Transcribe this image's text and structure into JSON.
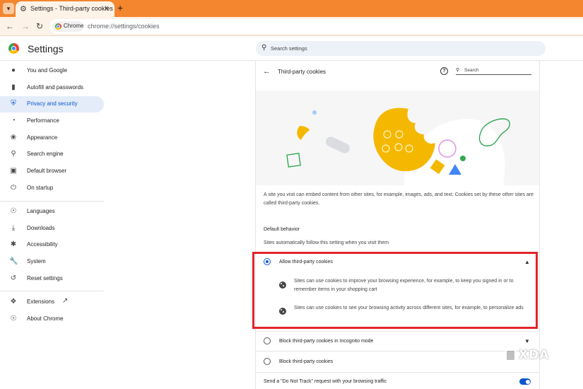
{
  "browser": {
    "tab_title": "Settings - Third-party cookies",
    "tab_menu_icon": "chevron-down-icon",
    "new_tab_label": "+",
    "close_label": "×",
    "site_chip": "Chrome",
    "url": "chrome://settings/cookies"
  },
  "header": {
    "title": "Settings",
    "search_placeholder": "Search settings"
  },
  "sidebar": {
    "items": [
      {
        "label": "You and Google",
        "icon": "person-icon"
      },
      {
        "label": "Autofill and passwords",
        "icon": "clipboard-icon"
      },
      {
        "label": "Privacy and security",
        "icon": "shield-icon",
        "active": true
      },
      {
        "label": "Performance",
        "icon": "speedometer-icon"
      },
      {
        "label": "Appearance",
        "icon": "palette-icon"
      },
      {
        "label": "Search engine",
        "icon": "search-icon"
      },
      {
        "label": "Default browser",
        "icon": "browser-icon"
      },
      {
        "label": "On startup",
        "icon": "power-icon"
      },
      {
        "label": "Languages",
        "icon": "globe-icon"
      },
      {
        "label": "Downloads",
        "icon": "download-icon"
      },
      {
        "label": "Accessibility",
        "icon": "accessibility-icon"
      },
      {
        "label": "System",
        "icon": "wrench-icon"
      },
      {
        "label": "Reset settings",
        "icon": "history-icon"
      },
      {
        "label": "Extensions",
        "icon": "puzzle-icon"
      },
      {
        "label": "About Chrome",
        "icon": "chrome-logo-icon"
      }
    ]
  },
  "page": {
    "title": "Third-party cookies",
    "search_placeholder": "Search",
    "intro": "A site you visit can embed content from other sites, for example, images, ads, and text. Cookies set by these other sites are called third-party cookies.",
    "default_behavior_label": "Default behavior",
    "default_behavior_sub": "Sites automatically follow this setting when you visit them",
    "options": [
      {
        "label": "Allow third-party cookies",
        "selected": true,
        "details": [
          "Sites can use cookies to improve your browsing experience, for example, to keep you signed in or to remember items in your shopping cart",
          "Sites can use cookies to see your browsing activity across different sites, for example, to personalize ads"
        ]
      },
      {
        "label": "Block third-party cookies in Incognito mode",
        "selected": false
      },
      {
        "label": "Block third-party cookies",
        "selected": false
      }
    ],
    "dnt_label": "Send a \"Do Not Track\" request with your browsing traffic",
    "dnt_enabled": true
  },
  "watermark": "XDA",
  "colors": {
    "tabstrip": "#f3862f",
    "accent": "#0b57d0",
    "highlight": "#e0252b",
    "cookie": "#f5b800"
  }
}
